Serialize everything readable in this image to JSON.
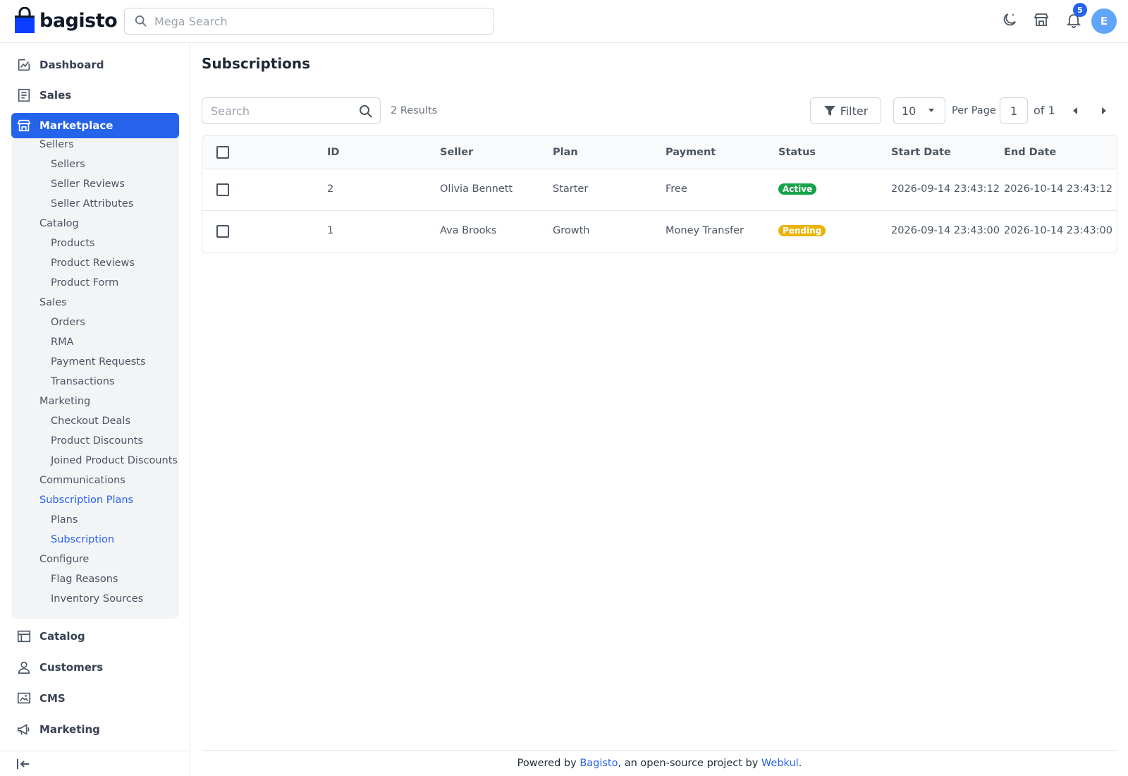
{
  "header": {
    "brand": "bagisto",
    "search_placeholder": "Mega Search",
    "notifications_count": "5",
    "avatar_initial": "E"
  },
  "sidebar": {
    "top_items": [
      {
        "label": "Dashboard",
        "icon": "dashboard-icon"
      },
      {
        "label": "Sales",
        "icon": "sales-icon"
      },
      {
        "label": "Marketplace",
        "icon": "marketplace-icon"
      }
    ],
    "marketplace_sub": [
      {
        "label": "Sellers",
        "level": 1
      },
      {
        "label": "Sellers",
        "level": 2
      },
      {
        "label": "Seller Reviews",
        "level": 2
      },
      {
        "label": "Seller Attributes",
        "level": 2
      },
      {
        "label": "Catalog",
        "level": 1
      },
      {
        "label": "Products",
        "level": 2
      },
      {
        "label": "Product Reviews",
        "level": 2
      },
      {
        "label": "Product Form",
        "level": 2
      },
      {
        "label": "Sales",
        "level": 1
      },
      {
        "label": "Orders",
        "level": 2
      },
      {
        "label": "RMA",
        "level": 2
      },
      {
        "label": "Payment Requests",
        "level": 2
      },
      {
        "label": "Transactions",
        "level": 2
      },
      {
        "label": "Marketing",
        "level": 1
      },
      {
        "label": "Checkout Deals",
        "level": 2
      },
      {
        "label": "Product Discounts",
        "level": 2
      },
      {
        "label": "Joined Product Discounts",
        "level": 2
      },
      {
        "label": "Communications",
        "level": 1
      },
      {
        "label": "Subscription Plans",
        "level": 1
      },
      {
        "label": "Plans",
        "level": 2
      },
      {
        "label": "Subscription",
        "level": 2
      },
      {
        "label": "Configure",
        "level": 1
      },
      {
        "label": "Flag Reasons",
        "level": 2
      },
      {
        "label": "Inventory Sources",
        "level": 2
      }
    ],
    "bottom_items": [
      {
        "label": "Catalog",
        "icon": "catalog-icon"
      },
      {
        "label": "Customers",
        "icon": "customers-icon"
      },
      {
        "label": "CMS",
        "icon": "cms-icon"
      },
      {
        "label": "Marketing",
        "icon": "marketing-icon"
      }
    ]
  },
  "main": {
    "title": "Subscriptions",
    "search_placeholder": "Search",
    "results": "2 Results",
    "filter_label": "Filter",
    "per_page_value": "10",
    "per_page_label": "Per Page",
    "page_current": "1",
    "page_of": "of 1"
  },
  "table": {
    "columns": [
      "ID",
      "Seller",
      "Plan",
      "Payment",
      "Status",
      "Start Date",
      "End Date"
    ],
    "rows": [
      {
        "id": "2",
        "seller": "Olivia Bennett",
        "plan": "Starter",
        "payment": "Free",
        "status": "Active",
        "start": "2026-09-14 23:43:12",
        "end": "2026-10-14 23:43:12"
      },
      {
        "id": "1",
        "seller": "Ava Brooks",
        "plan": "Growth",
        "payment": "Money Transfer",
        "status": "Pending",
        "start": "2026-09-14 23:43:00",
        "end": "2026-10-14 23:43:00"
      }
    ]
  },
  "status_colors": {
    "Active": "#16a34a",
    "Pending": "#eab308"
  },
  "accent_color": "#2563eb",
  "footer": {
    "prefix": "Powered by ",
    "link1": "Bagisto",
    "middle": ", an open-source project by ",
    "link2": "Webkul",
    "suffix": "."
  }
}
